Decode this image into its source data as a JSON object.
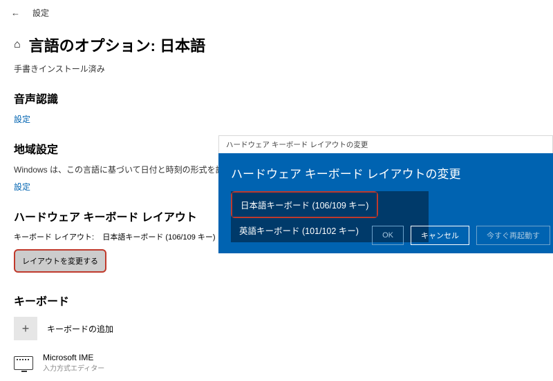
{
  "header": {
    "title": "設定"
  },
  "page": {
    "title": "言語のオプション: 日本語",
    "subtitle": "手書きインストール済み"
  },
  "sections": {
    "speech": {
      "heading": "音声認識",
      "link": "設定"
    },
    "region": {
      "heading": "地域設定",
      "text": "Windows は、この言語に基づいて日付と時刻の形式を設",
      "link": "設定"
    },
    "hwkb": {
      "heading": "ハードウェア キーボード レイアウト",
      "layout_label": "キーボード レイアウト:",
      "layout_value": "日本語キーボード (106/109 キー)",
      "change_button": "レイアウトを変更する"
    },
    "keyboard": {
      "heading": "キーボード",
      "add_label": "キーボードの追加",
      "ime_name": "Microsoft IME",
      "ime_desc": "入力方式エディター"
    }
  },
  "dialog": {
    "titlebar": "ハードウェア キーボード レイアウトの変更",
    "heading": "ハードウェア キーボード レイアウトの変更",
    "options": [
      "日本語キーボード (106/109 キー)",
      "英語キーボード (101/102 キー)"
    ],
    "buttons": {
      "ok": "OK",
      "cancel": "キャンセル",
      "restart": "今すぐ再起動す"
    }
  },
  "colors": {
    "accent": "#0063b1",
    "highlight_border": "#c0392b"
  }
}
